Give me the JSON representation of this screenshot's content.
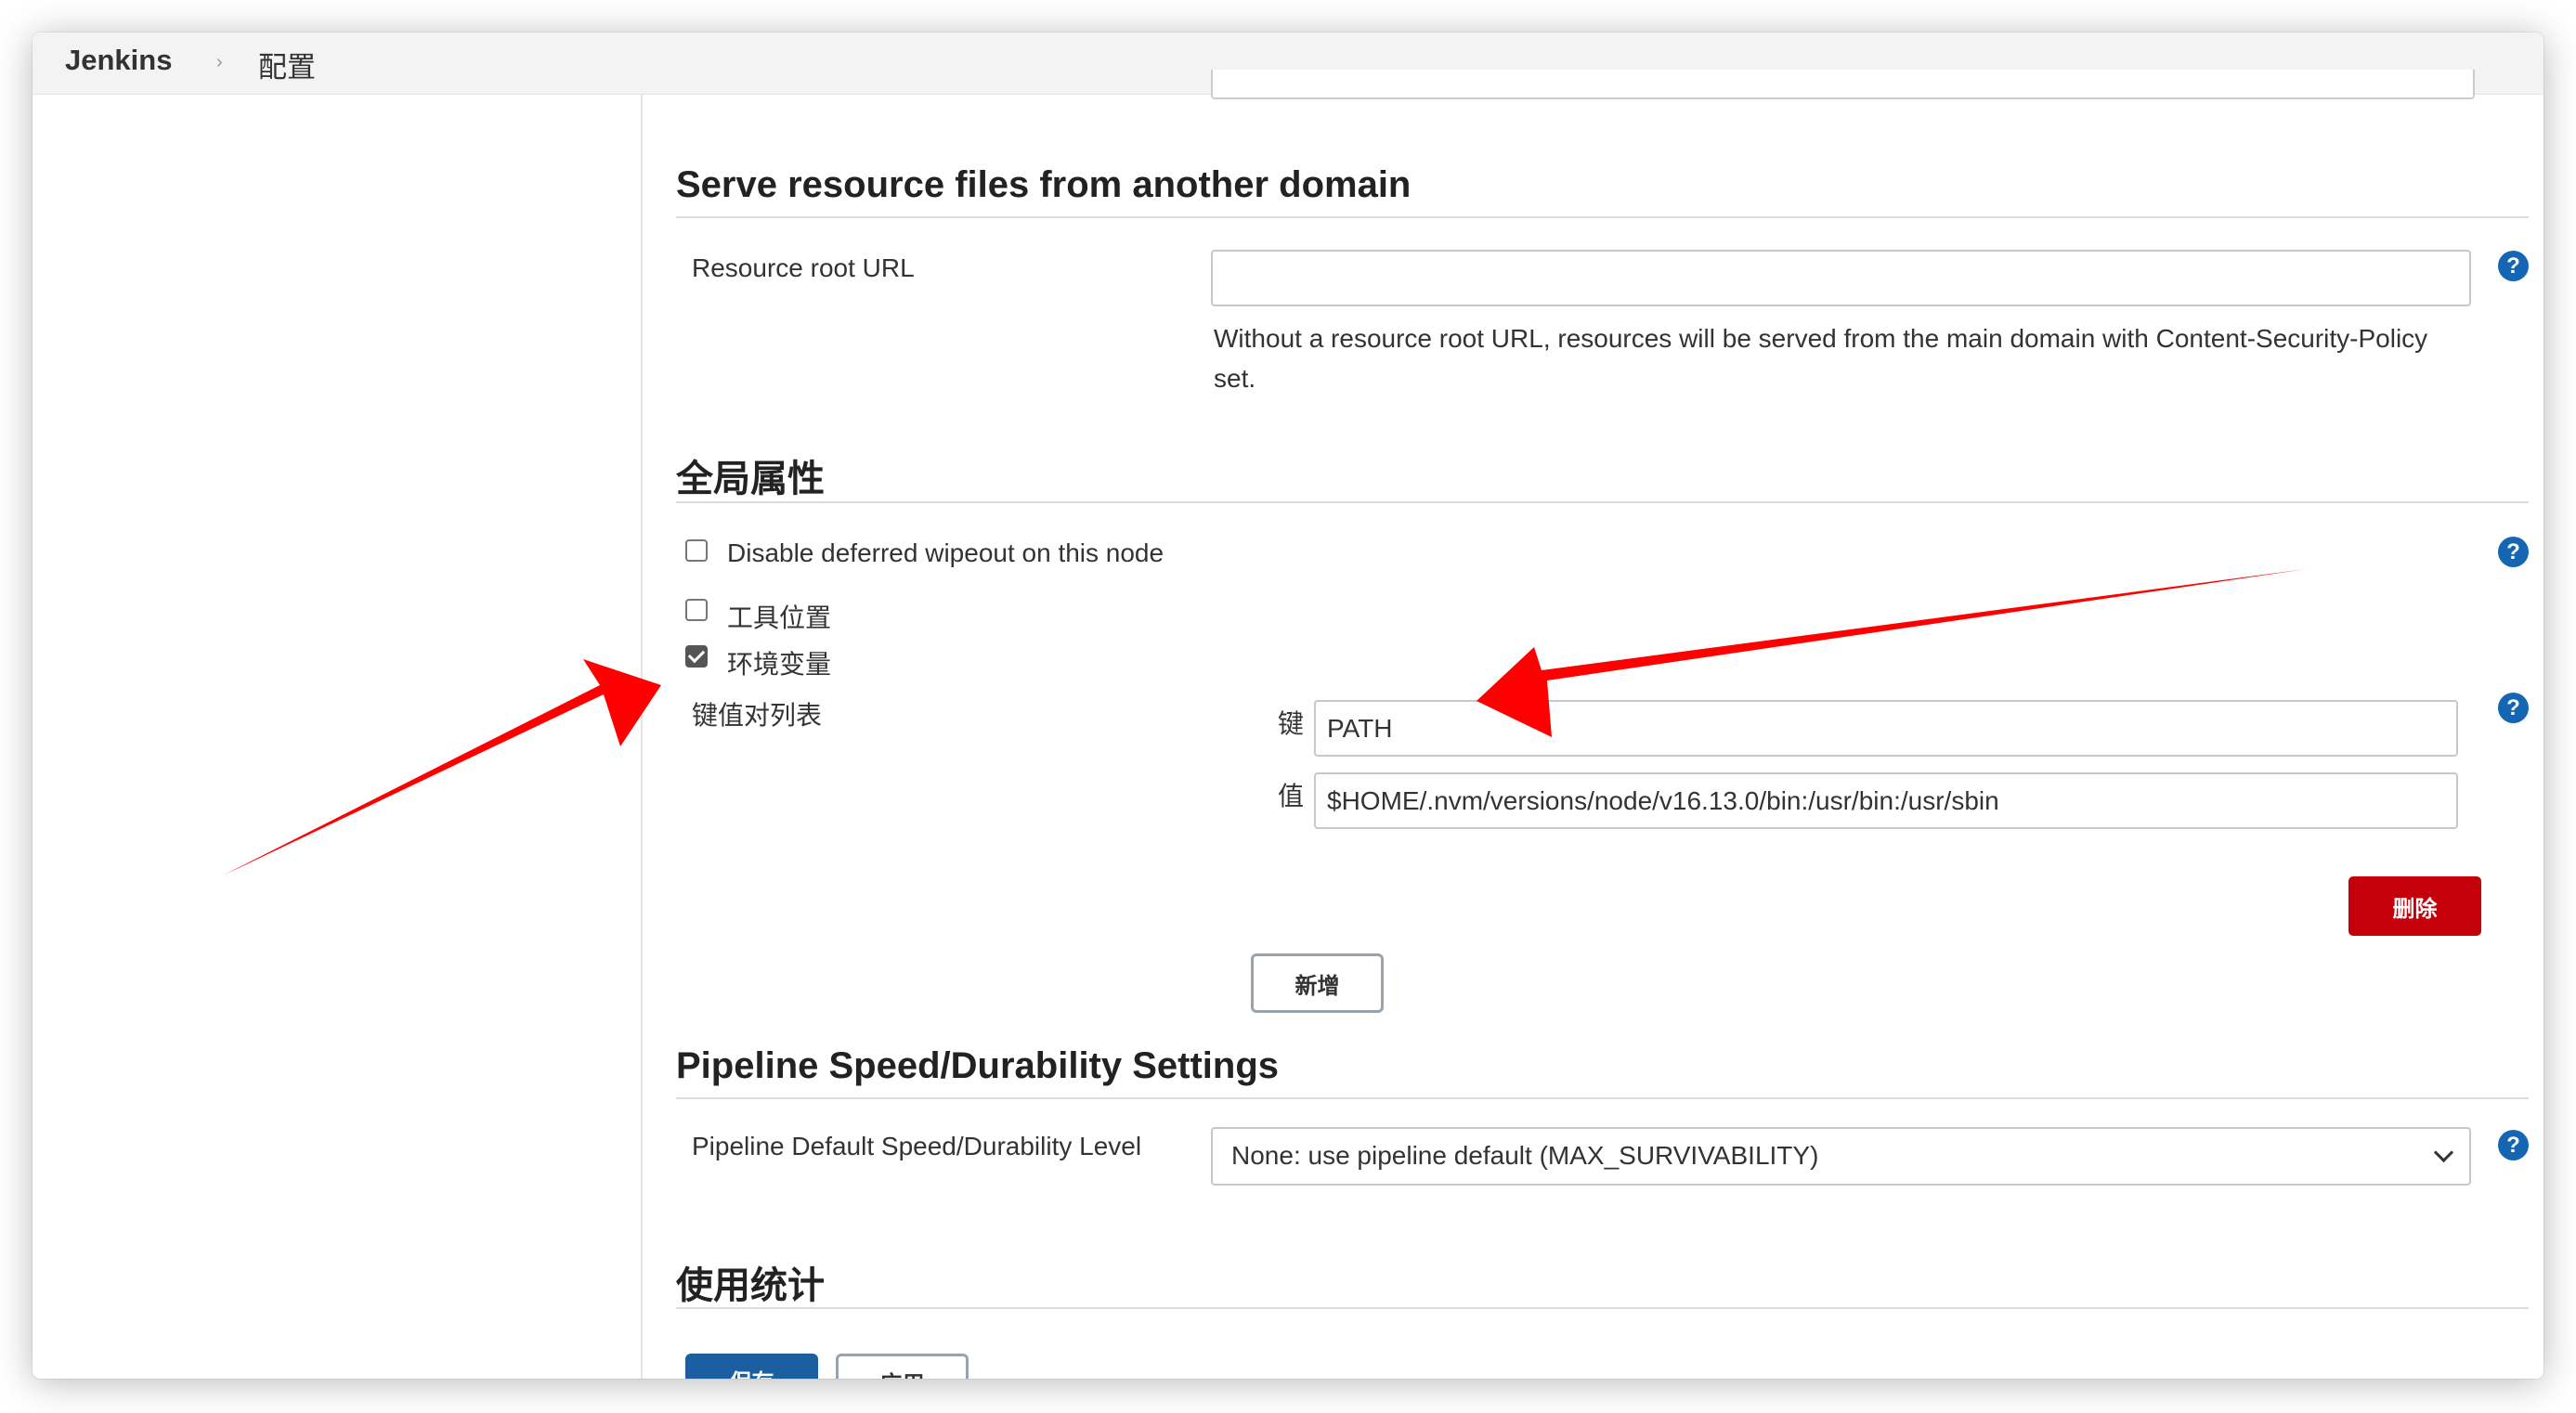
{
  "breadcrumb": {
    "home": "Jenkins",
    "separator": "›",
    "current": "配置"
  },
  "resource_section": {
    "title": "Serve resource files from another domain",
    "root_url_label": "Resource root URL",
    "root_url_value": "",
    "description": "Without a resource root URL, resources will be served from the main domain with Content-Security-Policy set."
  },
  "global_props": {
    "title": "全局属性",
    "disable_wipeout": {
      "label": "Disable deferred wipeout on this node",
      "checked": false
    },
    "tool_locations": {
      "label": "工具位置",
      "checked": false
    },
    "env_vars": {
      "label": "环境变量",
      "checked": true
    },
    "kv_list_label": "键值对列表",
    "key_label": "键",
    "key_value": "PATH",
    "value_label": "值",
    "value_value": "$HOME/.nvm/versions/node/v16.13.0/bin:/usr/bin:/usr/sbin",
    "delete_button": "删除",
    "add_button": "新增"
  },
  "pipeline_section": {
    "title": "Pipeline Speed/Durability Settings",
    "level_label": "Pipeline Default Speed/Durability Level",
    "level_selected": "None: use pipeline default (MAX_SURVIVABILITY)"
  },
  "usage_section": {
    "title": "使用统计"
  },
  "footer": {
    "save_button": "保存",
    "apply_button": "应用"
  },
  "help_icon_glyph": "?",
  "colors": {
    "help": "#1465b3",
    "danger": "#c4000a",
    "primary": "#1b5fa0",
    "annotation_arrow": "#ff0000"
  }
}
